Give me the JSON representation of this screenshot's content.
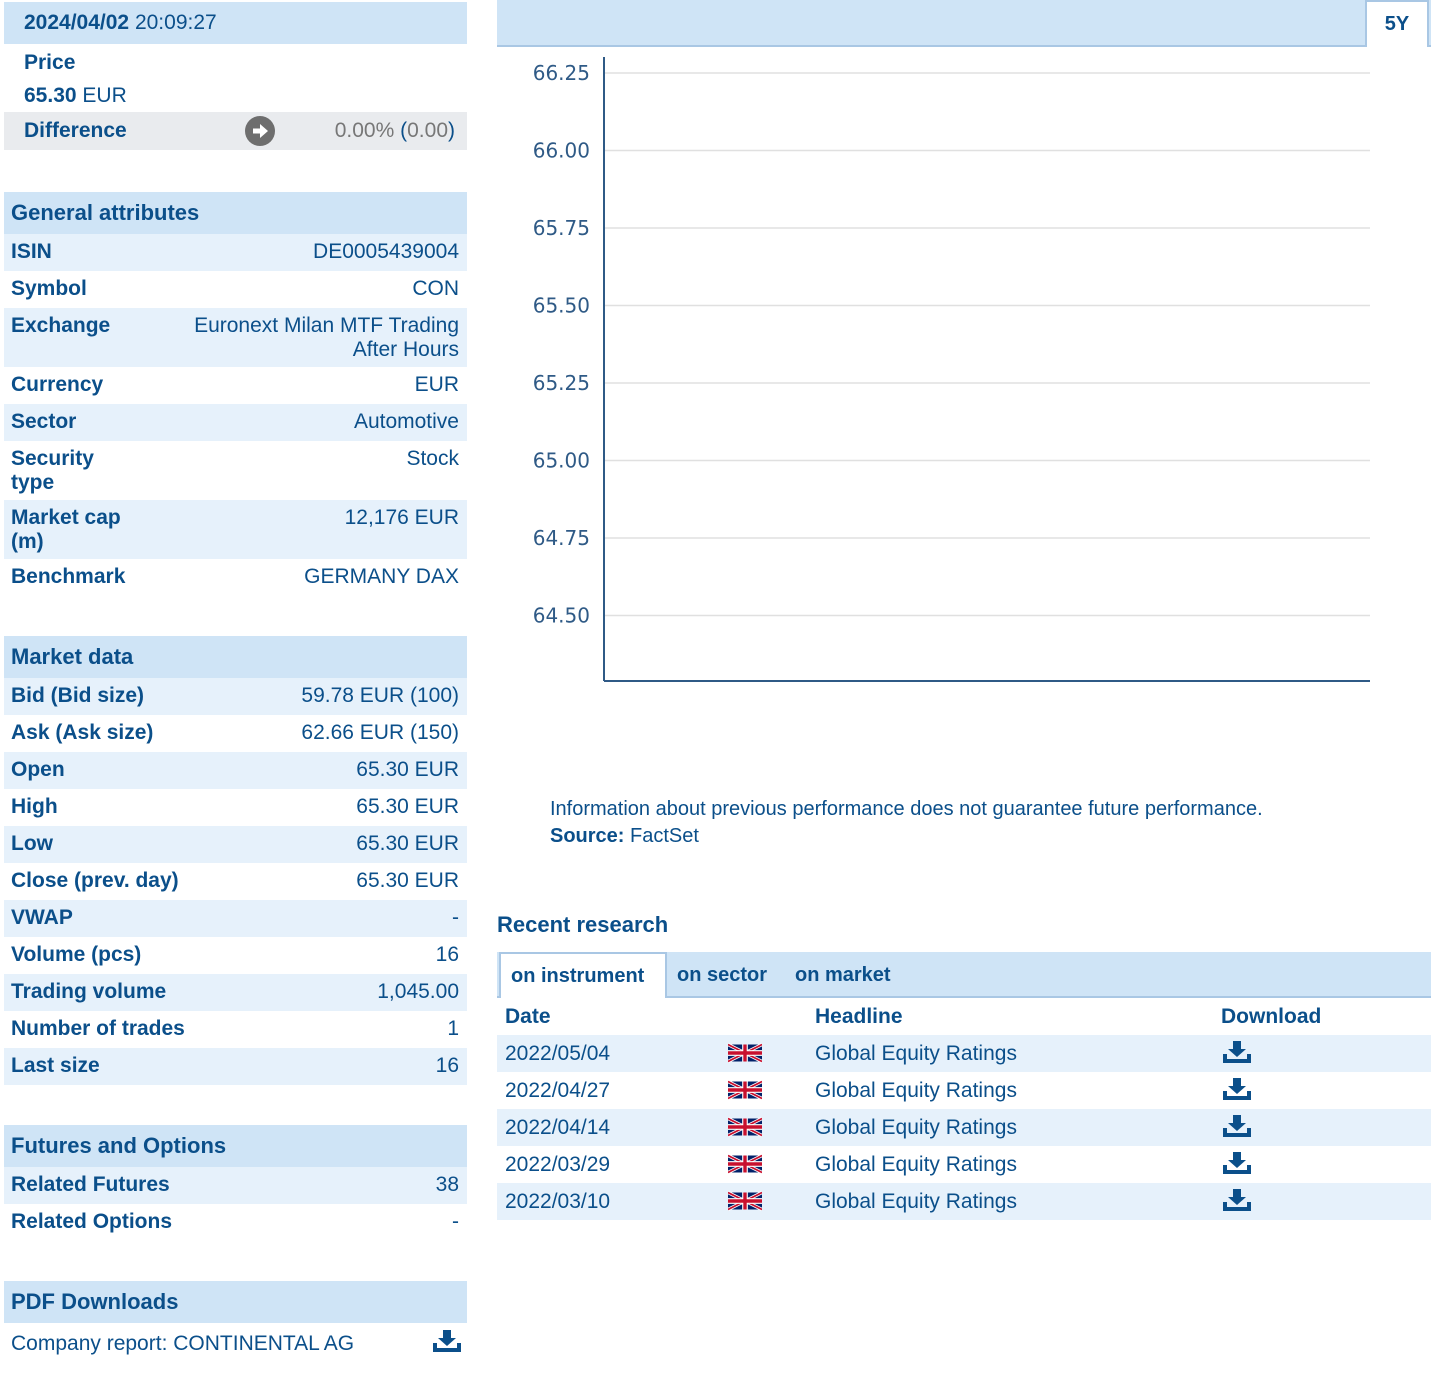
{
  "quote": {
    "date": "2024/04/02",
    "time": "20:09:27",
    "price_label": "Price",
    "price_value": "65.30",
    "price_currency": "EUR",
    "difference_label": "Difference",
    "difference_percent": "0.00%",
    "difference_abs": "0.00",
    "difference_icon": "arrow-right-icon"
  },
  "general": {
    "title": "General attributes",
    "rows": [
      {
        "k": "ISIN",
        "v": "DE0005439004"
      },
      {
        "k": "Symbol",
        "v": "CON"
      },
      {
        "k": "Exchange",
        "v": "Euronext Milan MTF Trading After Hours"
      },
      {
        "k": "Currency",
        "v": "EUR"
      },
      {
        "k": "Sector",
        "v": "Automotive"
      },
      {
        "k": "Security type",
        "v": "Stock"
      },
      {
        "k": "Market cap (m)",
        "v": "12,176 EUR"
      },
      {
        "k": "Benchmark",
        "v": "GERMANY DAX"
      }
    ]
  },
  "market": {
    "title": "Market data",
    "rows": [
      {
        "k": "Bid (Bid size)",
        "v": "59.78 EUR (100)"
      },
      {
        "k": "Ask (Ask size)",
        "v": "62.66 EUR (150)"
      },
      {
        "k": "Open",
        "v": "65.30 EUR"
      },
      {
        "k": "High",
        "v": "65.30 EUR"
      },
      {
        "k": "Low",
        "v": "65.30 EUR"
      },
      {
        "k": "Close (prev. day)",
        "v": "65.30 EUR"
      },
      {
        "k": "VWAP",
        "v": "-"
      },
      {
        "k": "Volume (pcs)",
        "v": "16"
      },
      {
        "k": "Trading volume",
        "v": "1,045.00"
      },
      {
        "k": "Number of trades",
        "v": "1"
      },
      {
        "k": "Last size",
        "v": "16"
      }
    ]
  },
  "futures": {
    "title": "Futures and Options",
    "rows": [
      {
        "k": "Related Futures",
        "v": "38"
      },
      {
        "k": "Related Options",
        "v": "-"
      }
    ]
  },
  "pdf": {
    "title": "PDF Downloads",
    "item": "Company report: CONTINENTAL AG",
    "icon": "download-icon"
  },
  "chart_tab": "5Y",
  "chart_data": {
    "type": "line",
    "y_ticks": [
      "66.25",
      "66.00",
      "65.75",
      "65.50",
      "65.25",
      "65.00",
      "64.75",
      "64.50"
    ],
    "ylim": [
      64.3,
      66.3
    ],
    "grid": true,
    "series": []
  },
  "disclaimer": {
    "text": "Information about previous performance does not guarantee future performance.",
    "source_label": "Source:",
    "source_value": "FactSet"
  },
  "research": {
    "title": "Recent research",
    "tabs": [
      "on instrument",
      "on sector",
      "on market"
    ],
    "headers": {
      "date": "Date",
      "headline": "Headline",
      "download": "Download"
    },
    "rows": [
      {
        "date": "2022/05/04",
        "lang": "uk-flag-icon",
        "headline": "Global Equity Ratings"
      },
      {
        "date": "2022/04/27",
        "lang": "uk-flag-icon",
        "headline": "Global Equity Ratings"
      },
      {
        "date": "2022/04/14",
        "lang": "uk-flag-icon",
        "headline": "Global Equity Ratings"
      },
      {
        "date": "2022/03/29",
        "lang": "uk-flag-icon",
        "headline": "Global Equity Ratings"
      },
      {
        "date": "2022/03/10",
        "lang": "uk-flag-icon",
        "headline": "Global Equity Ratings"
      }
    ]
  },
  "colors": {
    "header_bg": "#cfe4f6",
    "row_alt_bg": "#e6f1fb",
    "text_blue": "#0b4f8a",
    "axis": "#2f5a86",
    "grid": "#e0e0e0"
  }
}
